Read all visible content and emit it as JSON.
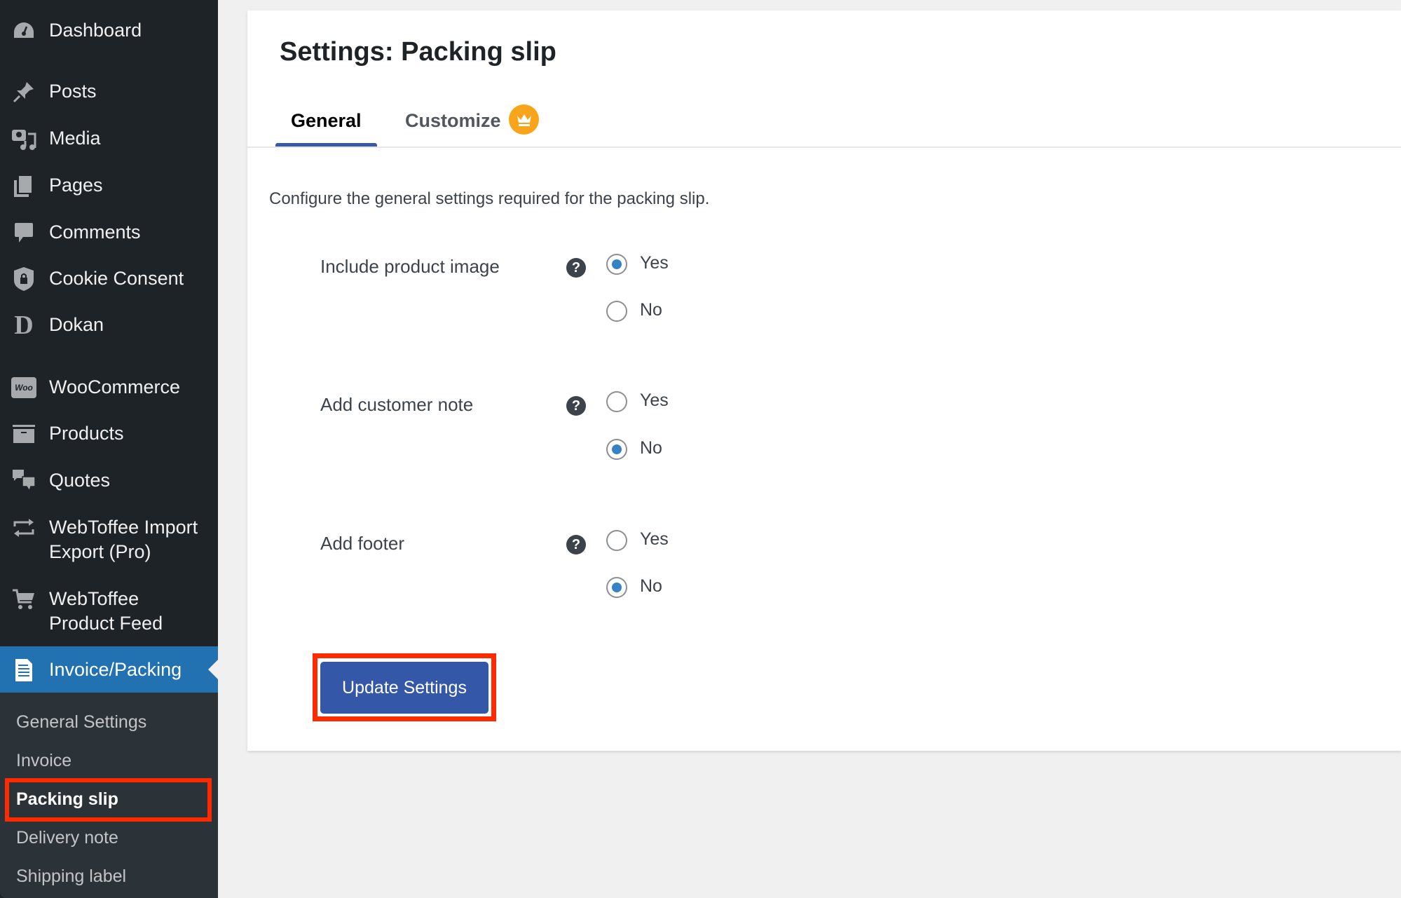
{
  "sidebar": {
    "items": [
      {
        "label": "Dashboard",
        "icon": "dashboard-icon"
      },
      {
        "label": "Posts",
        "icon": "pin-icon"
      },
      {
        "label": "Media",
        "icon": "media-icon"
      },
      {
        "label": "Pages",
        "icon": "pages-icon"
      },
      {
        "label": "Comments",
        "icon": "comment-icon"
      },
      {
        "label": "Cookie Consent",
        "icon": "shield-lock-icon"
      },
      {
        "label": "Dokan",
        "icon": "dokan-icon"
      },
      {
        "label": "WooCommerce",
        "icon": "woo-icon",
        "badge": "Woo"
      },
      {
        "label": "Products",
        "icon": "archive-box-icon"
      },
      {
        "label": "Quotes",
        "icon": "chat-bubbles-icon"
      },
      {
        "label_line1": "WebToffee Import",
        "label_line2": "Export (Pro)",
        "icon": "sync-arrows-icon"
      },
      {
        "label_line1": "WebToffee",
        "label_line2": "Product Feed",
        "icon": "cart-icon"
      },
      {
        "label": "Invoice/Packing",
        "icon": "document-icon",
        "active": true
      }
    ],
    "submenu": [
      {
        "label": "General Settings"
      },
      {
        "label": "Invoice"
      },
      {
        "label": "Packing slip",
        "current": true
      },
      {
        "label": "Delivery note"
      },
      {
        "label": "Shipping label"
      }
    ]
  },
  "page": {
    "title": "Settings: Packing slip",
    "tabs": [
      {
        "label": "General",
        "active": true
      },
      {
        "label": "Customize",
        "icon": "crown-icon"
      }
    ],
    "description": "Configure the general settings required for the packing slip.",
    "settings": [
      {
        "label": "Include product image",
        "help": "?",
        "options": [
          {
            "label": "Yes",
            "checked": true
          },
          {
            "label": "No",
            "checked": false
          }
        ]
      },
      {
        "label": "Add customer note",
        "help": "?",
        "options": [
          {
            "label": "Yes",
            "checked": false
          },
          {
            "label": "No",
            "checked": true
          }
        ]
      },
      {
        "label": "Add footer",
        "help": "?",
        "options": [
          {
            "label": "Yes",
            "checked": false
          },
          {
            "label": "No",
            "checked": true
          }
        ]
      }
    ],
    "submit_label": "Update Settings"
  },
  "colors": {
    "sidebar_bg": "#1d2327",
    "submenu_bg": "#2c3338",
    "active_menu": "#2271b1",
    "button": "#3457a8",
    "tab_underline": "#3858a8",
    "crown_badge": "#f8a51b",
    "radio_checked": "#3582c4",
    "highlight_box": "#ff2a00"
  }
}
